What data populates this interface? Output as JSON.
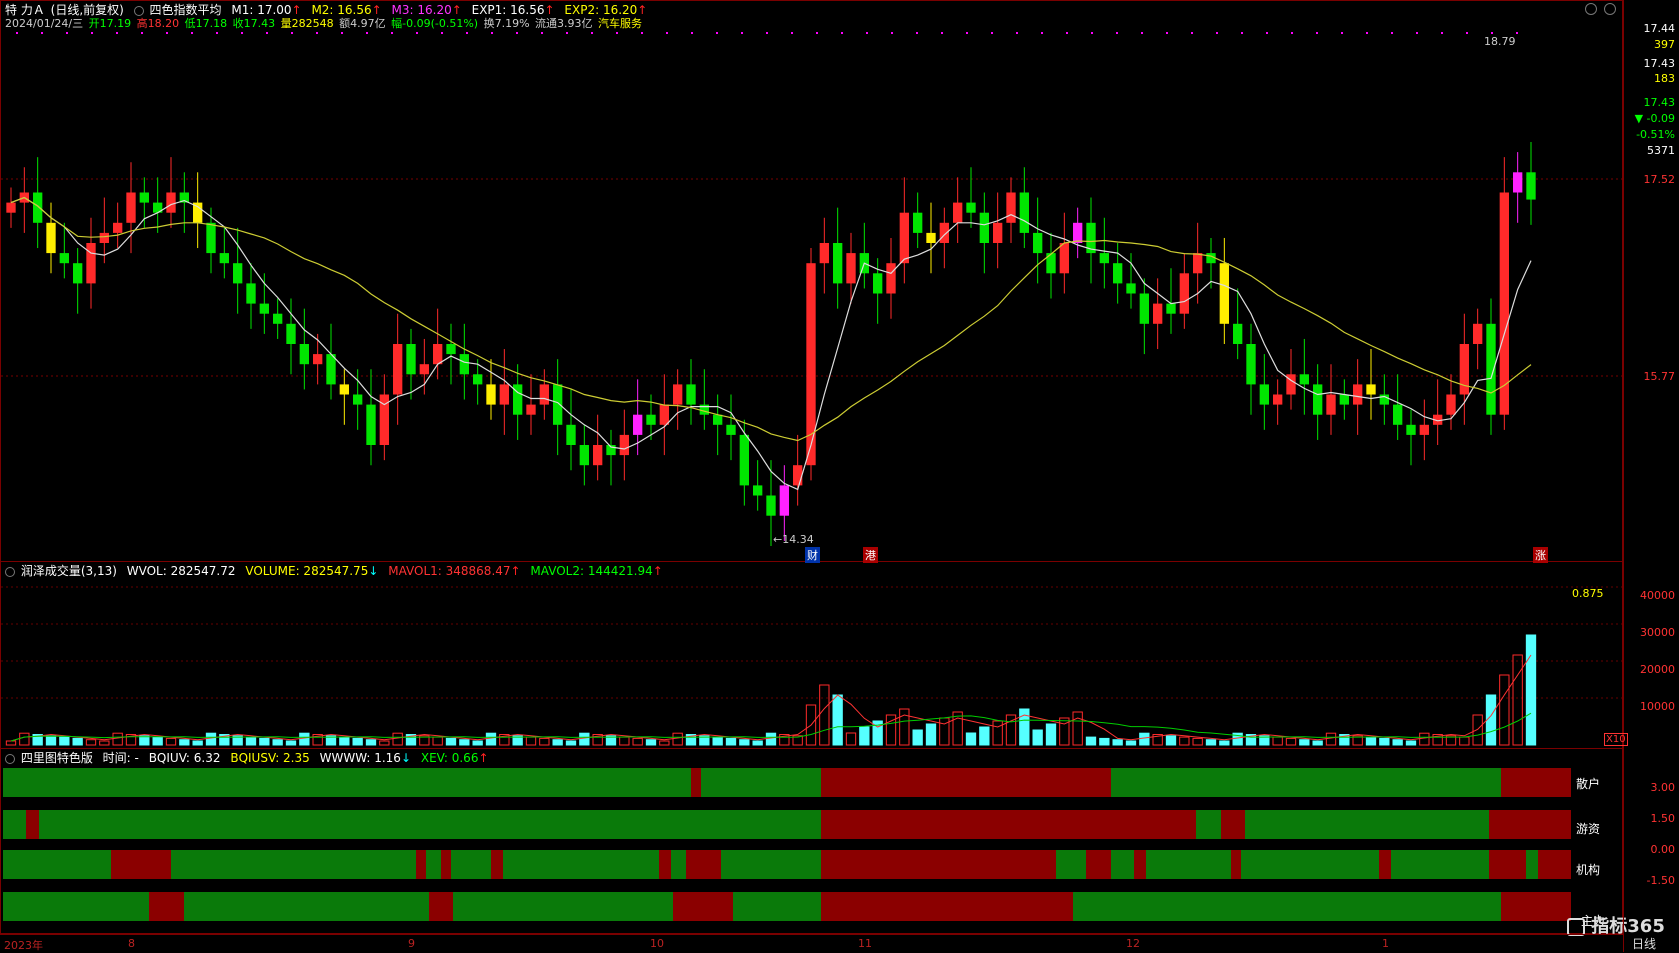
{
  "main_header": {
    "stock_name": "特 力Ａ",
    "mode": "(日线,前复权)",
    "indicator": "四色指数平均",
    "m1": "M1: 17.00",
    "m2": "M2: 16.56",
    "m3": "M3: 16.20",
    "exp1": "EXP1: 16.56",
    "exp2": "EXP2: 16.20"
  },
  "quote_line": {
    "date": "2024/01/24/三",
    "open": "开17.19",
    "high": "高18.20",
    "low": "低17.18",
    "close": "收17.43",
    "volume": "量282548",
    "amount": "额4.97亿",
    "change": "幅-0.09(-0.51%)",
    "turnover": "换7.19%",
    "float_cap": "流通3.93亿",
    "sector": "汽车服务"
  },
  "price_axis": {
    "p1": "17.44",
    "p2": "397",
    "p3": "17.43",
    "p4": "183",
    "p5": "17.43",
    "p6": "▼ -0.09",
    "p7": "-0.51%",
    "p8": "5371",
    "p9": "17.52",
    "p10": "15.77"
  },
  "price_annotations": {
    "high_mark": "18.79",
    "low_mark": "←14.34",
    "tag_cai": "财",
    "tag_gang": "港",
    "tag_zhang": "涨"
  },
  "vol_header": {
    "name": "润泽成交量(3,13)",
    "wvol": "WVOL: 282547.72",
    "volume": "VOLUME: 282547.75",
    "mavol1": "MAVOL1: 348868.47",
    "mavol2": "MAVOL2: 144421.94"
  },
  "vol_axis": {
    "v1": "40000",
    "v2": "30000",
    "v3": "20000",
    "v4": "10000",
    "unit": "X10",
    "ratio": "0.875"
  },
  "ind_header": {
    "name": "四里图特色版",
    "time": "时间: -",
    "bqiuv": "BQIUV: 6.32",
    "bqiusv": "BQIUSV: 2.35",
    "wwww": "WWWW: 1.16",
    "xev": "XEV: 0.66"
  },
  "ind_axis": {
    "a1": "3.00",
    "a2": "1.50",
    "a3": "0.00",
    "a4": "-1.50"
  },
  "band_labels": {
    "b1": "散户",
    "b2": "游资",
    "b3": "机构",
    "b4": "主力"
  },
  "time_axis": {
    "t0": "2023年",
    "t1": "8",
    "t2": "9",
    "t3": "10",
    "t4": "11",
    "t5": "12",
    "t6": "1",
    "period": "日线"
  },
  "watermark": "指标365",
  "colors": {
    "up": "#ff2a2a",
    "down": "#00e600",
    "up_alt": "#ff22ff",
    "down_alt": "#ffee00",
    "vol_down": "#55ffff",
    "band_green": "#0a7a0a",
    "band_red": "#8b0000",
    "ma_short": "#dddddd",
    "ma_long": "#cccc33"
  },
  "chart_data": {
    "type": "candlestick",
    "ylim": [
      14.0,
      19.0
    ],
    "candles_close": [
      17.4,
      17.5,
      17.2,
      16.9,
      16.8,
      16.6,
      17.0,
      17.1,
      17.2,
      17.5,
      17.4,
      17.3,
      17.5,
      17.4,
      17.2,
      16.9,
      16.8,
      16.6,
      16.4,
      16.3,
      16.2,
      16.0,
      15.8,
      15.9,
      15.6,
      15.5,
      15.4,
      15.0,
      15.5,
      16.0,
      15.7,
      15.8,
      16.0,
      15.9,
      15.7,
      15.6,
      15.4,
      15.6,
      15.3,
      15.4,
      15.6,
      15.2,
      15.0,
      14.8,
      15.0,
      14.9,
      15.1,
      15.3,
      15.2,
      15.4,
      15.6,
      15.4,
      15.3,
      15.2,
      15.1,
      14.6,
      14.5,
      14.3,
      14.6,
      14.8,
      16.8,
      17.0,
      16.6,
      16.9,
      16.7,
      16.5,
      16.8,
      17.3,
      17.1,
      17.0,
      17.2,
      17.4,
      17.3,
      17.0,
      17.2,
      17.5,
      17.1,
      16.9,
      16.7,
      17.0,
      17.2,
      16.9,
      16.8,
      16.6,
      16.5,
      16.2,
      16.4,
      16.3,
      16.7,
      16.9,
      16.8,
      16.2,
      16.0,
      15.6,
      15.4,
      15.5,
      15.7,
      15.6,
      15.3,
      15.5,
      15.4,
      15.6,
      15.5,
      15.4,
      15.2,
      15.1,
      15.2,
      15.3,
      15.5,
      16.0,
      16.2,
      15.3,
      17.5,
      17.7,
      17.43
    ]
  }
}
